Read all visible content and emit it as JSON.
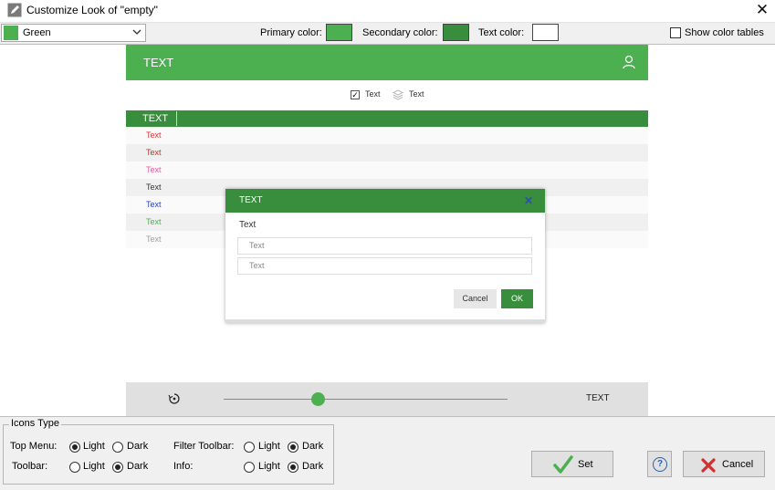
{
  "window": {
    "title": "Customize Look of \"empty\""
  },
  "toolbar": {
    "theme_select_value": "Green",
    "primary_label": "Primary color:",
    "secondary_label": "Secondary color:",
    "text_label": "Text color:",
    "show_color_tables_label": "Show color tables",
    "show_color_tables_checked": false
  },
  "colors": {
    "primary": "#4caf50",
    "secondary": "#388e3c",
    "text": "#ffffff"
  },
  "preview": {
    "header_text": "TEXT",
    "checkbox_text": "Text",
    "layers_text": "Text",
    "table_header": "TEXT",
    "rows": [
      {
        "text": "Text",
        "color": "#d9383a"
      },
      {
        "text": "Text",
        "color": "#b03a2e"
      },
      {
        "text": "Text",
        "color": "#e05c9e"
      },
      {
        "text": "Text",
        "color": "#333333"
      },
      {
        "text": "Text",
        "color": "#2b3fc7"
      },
      {
        "text": "Text",
        "color": "#4caf50"
      },
      {
        "text": "Text",
        "color": "#9e9e9e"
      }
    ],
    "dialog": {
      "title": "TEXT",
      "close_glyph": "✕",
      "label": "Text",
      "input1_placeholder": "Text",
      "input2_placeholder": "Text",
      "cancel_label": "Cancel",
      "ok_label": "OK"
    },
    "player_text": "TEXT",
    "slider_level": 0.33
  },
  "icons_type": {
    "legend": "Icons Type",
    "top_menu_label": "Top Menu:",
    "toolbar_label": "Toolbar:",
    "filter_toolbar_label": "Filter Toolbar:",
    "info_label": "Info:",
    "light": "Light",
    "dark": "Dark",
    "top_menu": "Light",
    "toolbar": "Dark",
    "filter_toolbar": "Dark",
    "info": "Dark"
  },
  "buttons": {
    "set": "Set",
    "help": "?",
    "cancel": "Cancel"
  },
  "icons": {
    "title": "pencil-icon",
    "user": "user-icon",
    "layers": "layers-icon",
    "player": "replay-icon",
    "set": "checkmark-icon",
    "help": "help-icon",
    "cancel": "red-x-icon"
  }
}
